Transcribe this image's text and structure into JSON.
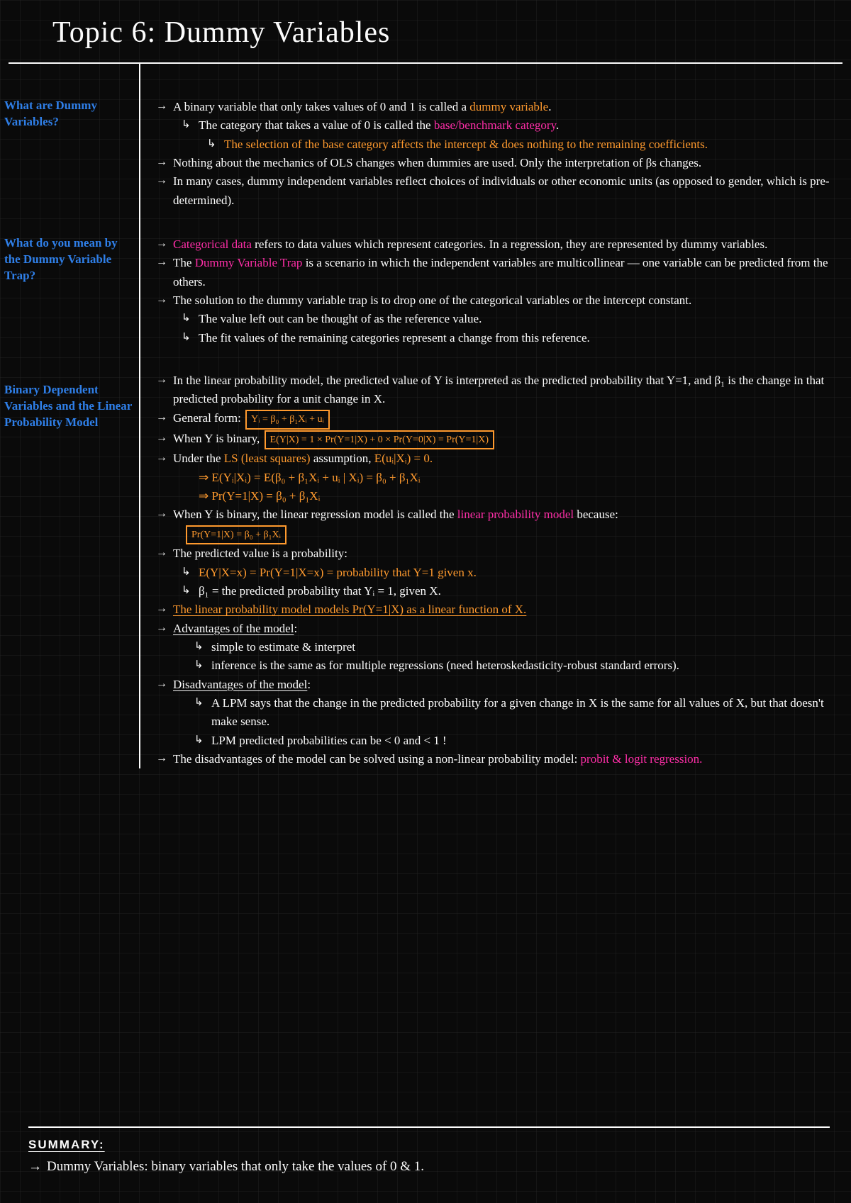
{
  "title": "Topic 6: Dummy Variables",
  "q1": "What are Dummy Variables?",
  "q2": "What do you mean by the Dummy Variable Trap?",
  "q3": "Binary Dependent Variables and the Linear Probability Model",
  "s1": {
    "l1a": "A binary variable that only takes values of 0 and 1 is called a ",
    "l1b": "dummy variable",
    "l1c": ".",
    "l2a": "The category that takes a value of 0 is called the ",
    "l2b": "base/benchmark category",
    "l2c": ".",
    "l3": "The selection of the base category affects the intercept & does nothing to the remaining coefficients.",
    "l4": "Nothing about the mechanics of OLS changes when dummies are used. Only the interpretation of βs changes.",
    "l5": "In many cases, dummy independent variables reflect choices of individuals or other economic units (as opposed to gender, which is pre-determined)."
  },
  "s2": {
    "l1a": "Categorical data",
    "l1b": " refers to data values which represent categories. In a regression, they are represented by dummy variables.",
    "l2a": "The ",
    "l2b": "Dummy Variable Trap",
    "l2c": " is a scenario in which the independent variables are multicollinear — one variable can be predicted from the others.",
    "l3": "The solution to the dummy variable trap is to drop one of the categorical variables or the intercept constant.",
    "l4": "The value left out can be thought of as the reference value.",
    "l5": "The fit values of the remaining categories represent a change from this reference."
  },
  "s3": {
    "l1": "In the linear probability model, the predicted value of Y is interpreted as the predicted probability that Y=1, and β₁ is the change in that predicted probability for a unit change in X.",
    "l2a": "General form: ",
    "l2b": "Yᵢ = β₀ + β₁Xᵢ + uᵢ",
    "l3a": "When Y is binary, ",
    "l3b": "E(Y|X) = 1 × Pr(Y=1|X) + 0 × Pr(Y=0|X) = Pr(Y=1|X)",
    "l4a": "Under the ",
    "l4b": "LS (least squares)",
    "l4c": " assumption, ",
    "l4d": "E(uᵢ|Xᵢ) = 0.",
    "l5a": "⇒",
    "l5b": " E(Yᵢ|Xᵢ) = E(β₀ + β₁Xᵢ + uᵢ | Xᵢ) = β₀ + β₁Xᵢ",
    "l6a": "⇒",
    "l6b": " Pr(Y=1|X) = β₀ + β₁Xᵢ",
    "l7a": "When Y is binary, the linear regression model is called the ",
    "l7b": "linear probability model",
    "l7c": " because:",
    "l8": "Pr(Y=1|X) = β₀ + β₁Xᵢ",
    "l9": "The predicted value is a probability:",
    "l10a": "E(Y|X=x) = Pr(Y=1|X=x) = probability that Y=1 given x.",
    "l11": "β₁ = the predicted probability that Yᵢ = 1, given X.",
    "l12": "The linear probability model models Pr(Y=1|X) as a linear function of X.",
    "l13": "Advantages of the model",
    "l14": "simple to estimate & interpret",
    "l15": "inference is the same as for multiple regressions (need heteroskedasticity-robust standard errors).",
    "l16": "Disadvantages of the model",
    "l17": "A LPM says that the change in the predicted probability for a given change in X is the same for all values of X, but that doesn't make sense.",
    "l18": "LPM predicted probabilities can be < 0 and < 1 !",
    "l19a": "The disadvantages of the model can be solved using a non-linear probability model: ",
    "l19b": "probit & logit regression."
  },
  "summary": {
    "title": "SUMMARY:",
    "l1": "Dummy Variables: binary variables that only take the values of 0 & 1."
  }
}
